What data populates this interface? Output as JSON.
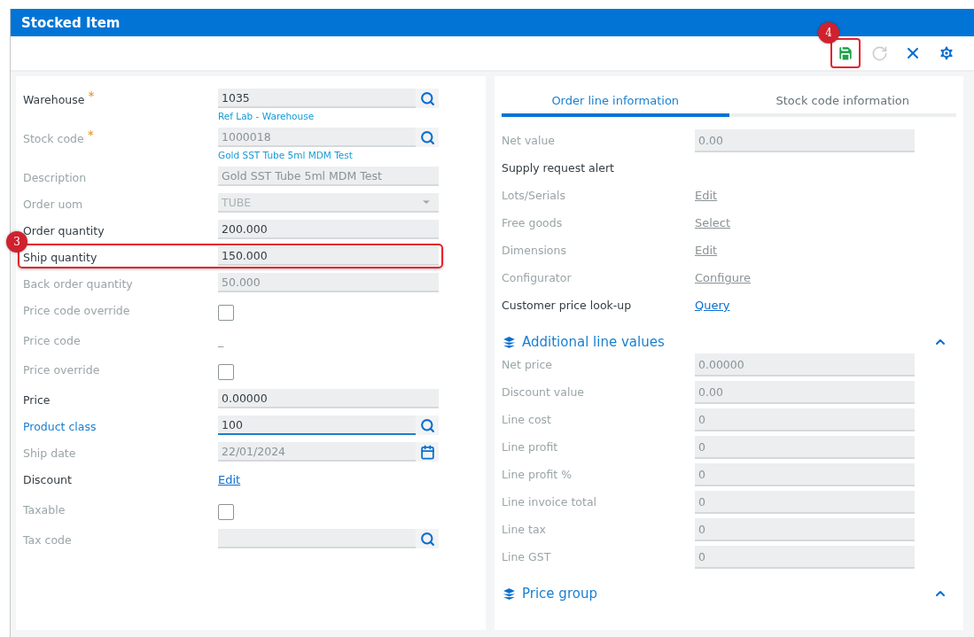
{
  "window": {
    "title": "Stocked Item"
  },
  "toolbar": [
    {
      "kind": "save",
      "disabled": false,
      "callout": "4"
    },
    {
      "kind": "refresh",
      "disabled": true
    },
    {
      "kind": "close",
      "disabled": false
    },
    {
      "kind": "settings",
      "disabled": false
    }
  ],
  "left_fields": [
    {
      "label": "Warehouse",
      "required_mark": "*",
      "disabled": false,
      "focused": false,
      "kind": "lookup",
      "value": "1035",
      "sublabel": "Ref Lab - Warehouse"
    },
    {
      "label": "Stock code",
      "required_mark": "*",
      "disabled": true,
      "focused": false,
      "kind": "lookup",
      "value": "1000018",
      "sublabel": "Gold SST Tube 5ml MDM Test"
    },
    {
      "label": "Description",
      "disabled": true,
      "focused": false,
      "kind": "text",
      "value": "Gold SST Tube 5ml MDM Test"
    },
    {
      "label": "Order uom",
      "disabled": true,
      "focused": false,
      "kind": "select",
      "value": "TUBE"
    },
    {
      "label": "Order quantity",
      "disabled": false,
      "focused": false,
      "kind": "text",
      "value": "200.000"
    },
    {
      "label": "Ship quantity",
      "disabled": false,
      "focused": false,
      "kind": "text",
      "value": "150.000",
      "callout": "3"
    },
    {
      "label": "Back order quantity",
      "disabled": true,
      "focused": false,
      "kind": "text",
      "value": "50.000"
    },
    {
      "label": "Price code override",
      "disabled": true,
      "focused": false,
      "kind": "checkbox",
      "checked": false
    },
    {
      "label": "Price code",
      "disabled": true,
      "focused": false,
      "kind": "plain",
      "value": "_"
    },
    {
      "label": "Price override",
      "disabled": true,
      "focused": false,
      "kind": "checkbox",
      "checked": false
    },
    {
      "label": "Price",
      "disabled": false,
      "focused": false,
      "kind": "text",
      "value": "0.00000"
    },
    {
      "label": "Product class",
      "disabled": false,
      "focused": true,
      "kind": "lookup",
      "value": "100"
    },
    {
      "label": "Ship date",
      "disabled": true,
      "focused": false,
      "kind": "date",
      "value": "22/01/2024"
    },
    {
      "label": "Discount",
      "disabled": false,
      "focused": false,
      "kind": "link",
      "value": "Edit"
    },
    {
      "label": "Taxable",
      "disabled": true,
      "focused": false,
      "kind": "checkbox",
      "checked": false
    },
    {
      "label": "Tax code",
      "disabled": true,
      "focused": false,
      "kind": "lookup"
    }
  ],
  "tabs": [
    {
      "label": "Order line information",
      "selected": true
    },
    {
      "label": "Stock code information",
      "selected": false
    }
  ],
  "right_fields": [
    {
      "label": "Net value",
      "disabled": true,
      "kind": "text",
      "value": "0.00"
    },
    {
      "label": "Supply request alert",
      "disabled": false,
      "kind": "none"
    },
    {
      "label": "Lots/Serials",
      "disabled": true,
      "kind": "link",
      "value": "Edit"
    },
    {
      "label": "Free goods",
      "disabled": true,
      "kind": "link",
      "value": "Select"
    },
    {
      "label": "Dimensions",
      "disabled": true,
      "kind": "link",
      "value": "Edit"
    },
    {
      "label": "Configurator",
      "disabled": true,
      "kind": "link",
      "value": "Configure"
    },
    {
      "label": "Customer price look-up",
      "disabled": false,
      "kind": "link",
      "value": "Query"
    }
  ],
  "sections": [
    {
      "title": "Additional line values",
      "expanded": true,
      "fields": [
        {
          "label": "Net price",
          "value": "0.00000"
        },
        {
          "label": "Discount value",
          "value": "0.00"
        },
        {
          "label": "Line cost",
          "value": "0"
        },
        {
          "label": "Line profit",
          "value": "0"
        },
        {
          "label": "Line profit %",
          "value": "0"
        },
        {
          "label": "Line invoice total",
          "value": "0"
        },
        {
          "label": "Line tax",
          "value": "0"
        },
        {
          "label": "Line GST",
          "value": "0"
        }
      ]
    },
    {
      "title": "Price group",
      "expanded": true
    }
  ]
}
